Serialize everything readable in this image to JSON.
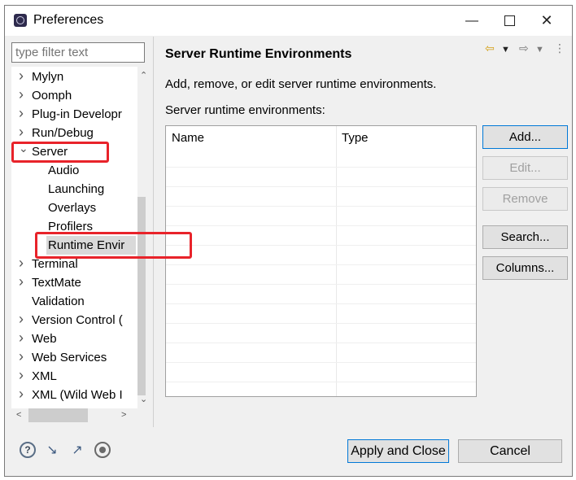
{
  "window": {
    "title": "Preferences",
    "controls": [
      "minimize",
      "maximize",
      "close"
    ]
  },
  "filter": {
    "placeholder": "type filter text"
  },
  "tree": [
    {
      "label": "Mylyn",
      "expanded": false,
      "child": false,
      "top": 0
    },
    {
      "label": "Oomph",
      "expanded": false,
      "child": false
    },
    {
      "label": "Plug-in Developr",
      "expanded": false,
      "child": false
    },
    {
      "label": "Run/Debug",
      "expanded": false,
      "child": false
    },
    {
      "label": "Server",
      "expanded": true,
      "child": false
    },
    {
      "label": "Audio",
      "child": true
    },
    {
      "label": "Launching",
      "child": true
    },
    {
      "label": "Overlays",
      "child": true
    },
    {
      "label": "Profilers",
      "child": true
    },
    {
      "label": "Runtime Envir",
      "child": true,
      "selected": true
    },
    {
      "label": "Terminal",
      "expanded": false,
      "child": false
    },
    {
      "label": "TextMate",
      "expanded": false,
      "child": false
    },
    {
      "label": "Validation",
      "child": false,
      "leaf": true
    },
    {
      "label": "Version Control (",
      "expanded": false,
      "child": false
    },
    {
      "label": "Web",
      "expanded": false,
      "child": false
    },
    {
      "label": "Web Services",
      "expanded": false,
      "child": false
    },
    {
      "label": "XML",
      "expanded": false,
      "child": false
    },
    {
      "label": "XML (Wild Web I",
      "expanded": false,
      "child": false
    }
  ],
  "page": {
    "title": "Server Runtime Environments",
    "description": "Add, remove, or edit server runtime environments.",
    "table_label": "Server runtime environments:",
    "columns": [
      "Name",
      "Type"
    ]
  },
  "buttons": {
    "add": "Add...",
    "edit": "Edit...",
    "remove": "Remove",
    "search": "Search...",
    "columns": "Columns..."
  },
  "footer": {
    "apply_close": "Apply and Close",
    "cancel": "Cancel"
  },
  "colors": {
    "highlight": "#e8232a",
    "default_border": "#0078d7"
  }
}
